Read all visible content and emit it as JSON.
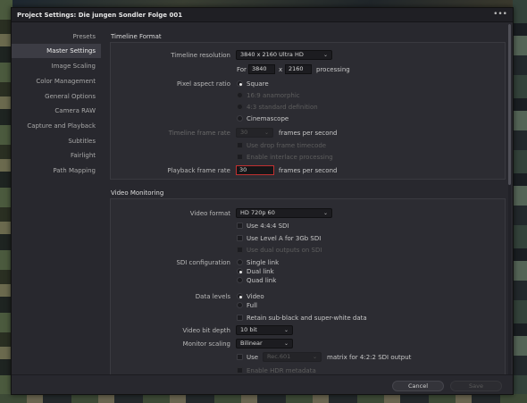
{
  "window": {
    "title": "Project Settings:  Die jungen Sondler Folge 001",
    "menu_glyph": "•••"
  },
  "sidebar": {
    "items": [
      {
        "label": "Presets"
      },
      {
        "label": "Master Settings"
      },
      {
        "label": "Image Scaling"
      },
      {
        "label": "Color Management"
      },
      {
        "label": "General Options"
      },
      {
        "label": "Camera RAW"
      },
      {
        "label": "Capture and Playback"
      },
      {
        "label": "Subtitles"
      },
      {
        "label": "Fairlight"
      },
      {
        "label": "Path Mapping"
      }
    ],
    "active_item": "Master Settings"
  },
  "timeline_format": {
    "heading": "Timeline Format",
    "resolution_label": "Timeline resolution",
    "resolution_value": "3840 x 2160 Ultra HD",
    "for_label": "For",
    "width_value": "3840",
    "x_label": "x",
    "height_value": "2160",
    "processing_label": "processing",
    "pixel_aspect_label": "Pixel aspect ratio",
    "pixel_aspect_options": [
      "Square",
      "16:9 anamorphic",
      "4:3 standard definition",
      "Cinemascope"
    ],
    "pixel_aspect_selected": "Square",
    "frame_rate_label": "Timeline frame rate",
    "frame_rate_value": "30",
    "frame_rate_unit": "frames per second",
    "drop_frame_label": "Use drop frame timecode",
    "interlace_label": "Enable interlace processing",
    "playback_rate_label": "Playback frame rate",
    "playback_rate_value": "30",
    "playback_rate_unit": "frames per second"
  },
  "video_monitoring": {
    "heading": "Video Monitoring",
    "video_format_label": "Video format",
    "video_format_value": "HD 720p 60",
    "use_444_label": "Use 4:4:4 SDI",
    "use_level_a_label": "Use Level A for 3Gb SDI",
    "dual_outputs_label": "Use dual outputs on SDI",
    "sdi_config_label": "SDI configuration",
    "sdi_options": [
      "Single link",
      "Dual link",
      "Quad link"
    ],
    "sdi_selected": "Dual link",
    "data_levels_label": "Data levels",
    "data_levels_options": [
      "Video",
      "Full"
    ],
    "data_levels_selected": "Video",
    "retain_label": "Retain sub-black and super-white data",
    "bit_depth_label": "Video bit depth",
    "bit_depth_value": "10 bit",
    "monitor_scaling_label": "Monitor scaling",
    "monitor_scaling_value": "Bilinear",
    "use_label": "Use",
    "rec_value": "Rec.601",
    "matrix_label": "matrix for 4:2:2 SDI output",
    "hdr_label": "Enable HDR metadata"
  },
  "footer": {
    "cancel_label": "Cancel",
    "save_label": "Save"
  },
  "colors": {
    "accent_focus": "#c03030",
    "dialog_bg": "#28282e",
    "sidebar_active": "#3c3c44"
  }
}
